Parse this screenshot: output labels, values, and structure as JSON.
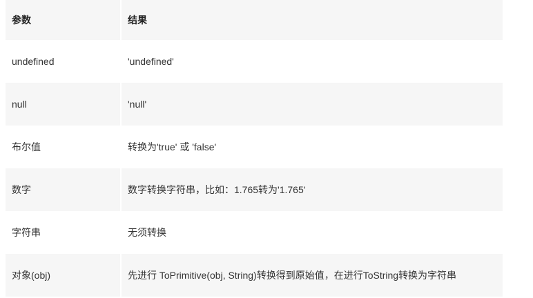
{
  "table": {
    "headers": [
      "参数",
      "结果"
    ],
    "rows": [
      {
        "param": "undefined",
        "result": "'undefined'"
      },
      {
        "param": "null",
        "result": "'null'"
      },
      {
        "param": "布尔值",
        "result": "转换为'true' 或 'false'"
      },
      {
        "param": "数字",
        "result": "数字转换字符串，比如：1.765转为'1.765'"
      },
      {
        "param": "字符串",
        "result": "无须转换"
      },
      {
        "param": "对象(obj)",
        "result": "先进行 ToPrimitive(obj, String)转换得到原始值，在进行ToString转换为字符串"
      }
    ]
  },
  "colors": {
    "shaded_row": "#f6f6f6",
    "plain_row": "#ffffff",
    "text": "#333333"
  }
}
